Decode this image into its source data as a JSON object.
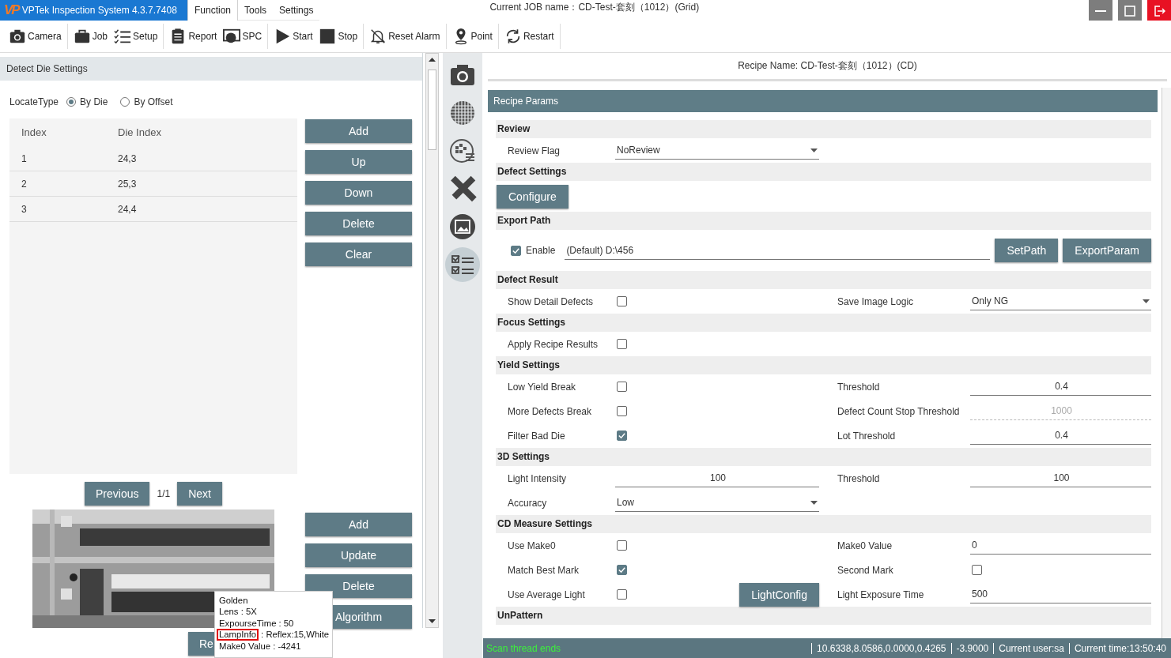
{
  "app": {
    "logo": "VP",
    "title": "VPTek Inspection System 4.3.7.7408"
  },
  "menu": [
    {
      "label": "Function",
      "selected": true
    },
    {
      "label": "Tools",
      "selected": false
    },
    {
      "label": "Settings",
      "selected": false
    }
  ],
  "job_name": "Current JOB name：CD-Test-套刻（1012）(Grid)",
  "toolbar": [
    {
      "items": [
        {
          "label": "Camera"
        }
      ]
    },
    {
      "items": [
        {
          "label": "Job"
        },
        {
          "label": "Setup"
        }
      ]
    },
    {
      "items": [
        {
          "label": "Report"
        },
        {
          "label": "SPC"
        }
      ]
    },
    {
      "items": [
        {
          "label": "Start"
        },
        {
          "label": "Stop"
        }
      ]
    },
    {
      "items": [
        {
          "label": "Reset Alarm"
        }
      ]
    },
    {
      "items": [
        {
          "label": "Point"
        }
      ]
    },
    {
      "items": [
        {
          "label": "Restart"
        }
      ]
    }
  ],
  "detect_die": {
    "title": "Detect Die Settings",
    "locate_type": {
      "label": "LocateType",
      "options": [
        {
          "label": "By Die",
          "selected": true
        },
        {
          "label": "By Offset",
          "selected": false
        }
      ]
    },
    "table": {
      "columns": [
        "Index",
        "Die Index"
      ],
      "rows": [
        [
          "1",
          "24,3"
        ],
        [
          "2",
          "25,3"
        ],
        [
          "3",
          "24,4"
        ]
      ]
    },
    "buttons": [
      "Add",
      "Up",
      "Down",
      "Delete",
      "Clear"
    ],
    "pager": {
      "previous": "Previous",
      "page": "1/1",
      "next": "Next"
    },
    "image": {
      "kind": "picture"
    },
    "image_buttons": [
      "Add",
      "Update",
      "Delete",
      "Algorithm"
    ],
    "bottom_button": "Re",
    "tooltip": [
      {
        "text": "Golden"
      },
      {
        "text": "Lens : 5X"
      },
      {
        "text": "ExpourseTime : 50"
      },
      {
        "highlight": "LampInfo",
        "text": ": Reflex:15,White"
      },
      {
        "text": "Make0 Value : -4241"
      }
    ]
  },
  "sidebar": [
    {
      "selected": false
    },
    {
      "selected": false
    },
    {
      "selected": false
    },
    {
      "selected": false
    },
    {
      "selected": false
    },
    {
      "selected": true
    }
  ],
  "recipe": {
    "name": "Recipe Name: CD-Test-套刻（1012）(CD)",
    "title": "Recipe Params",
    "sections": [
      {
        "title": "Review",
        "rows": [
          {
            "kind": "pair",
            "label": "Review Flag",
            "control": {
              "kind": "dropdown",
              "value": "NoReview"
            }
          }
        ]
      },
      {
        "title": "Defect Settings",
        "rows": [
          {
            "kind": "button",
            "label": "Configure"
          }
        ]
      },
      {
        "title": "Export Path",
        "rows": [
          {
            "kind": "path",
            "checkbox": {
              "label": "Enable",
              "checked": true
            },
            "value": "(Default) D:\\456",
            "buttons": [
              "SetPath",
              "ExportParam"
            ]
          }
        ]
      },
      {
        "title": "Defect Result",
        "rows": [
          {
            "kind": "pair",
            "label": "Show Detail Defects",
            "control": {
              "kind": "checkbox",
              "checked": false
            },
            "right_label": "Save Image Logic",
            "right_control": {
              "kind": "dropdown",
              "value": "Only NG"
            }
          }
        ]
      },
      {
        "title": "Focus Settings",
        "rows": [
          {
            "kind": "pair",
            "label": "Apply Recipe Results",
            "control": {
              "kind": "checkbox",
              "checked": false
            }
          }
        ]
      },
      {
        "title": "Yield Settings",
        "rows": [
          {
            "kind": "pair",
            "label": "Low Yield Break",
            "control": {
              "kind": "checkbox",
              "checked": false
            },
            "right_label": "Threshold",
            "right_control": {
              "kind": "number",
              "value": "0.4",
              "disabled": false
            }
          },
          {
            "kind": "pair",
            "label": "More Defects Break",
            "control": {
              "kind": "checkbox",
              "checked": false
            },
            "right_label": "Defect Count Stop Threshold",
            "right_control": {
              "kind": "number",
              "value": "1000",
              "disabled": true
            }
          },
          {
            "kind": "pair",
            "label": "Filter Bad Die",
            "control": {
              "kind": "checkbox",
              "checked": true
            },
            "right_label": "Lot Threshold",
            "right_control": {
              "kind": "number",
              "value": "0.4",
              "disabled": false
            }
          }
        ]
      },
      {
        "title": "3D Settings",
        "rows": [
          {
            "kind": "pair",
            "label": "Light Intensity",
            "control": {
              "kind": "number",
              "value": "100",
              "disabled": false
            },
            "right_label": "Threshold",
            "right_control": {
              "kind": "number",
              "value": "100",
              "disabled": false
            }
          },
          {
            "kind": "pair",
            "label": "Accuracy",
            "control": {
              "kind": "dropdown",
              "value": "Low"
            }
          }
        ]
      },
      {
        "title": "CD Measure Settings",
        "rows": [
          {
            "kind": "pair",
            "label": "Use Make0",
            "control": {
              "kind": "checkbox",
              "checked": false
            },
            "right_label": "Make0 Value",
            "right_control": {
              "kind": "field",
              "value": "0",
              "disabled": false
            }
          },
          {
            "kind": "pair",
            "label": "Match Best Mark",
            "control": {
              "kind": "checkbox",
              "checked": true
            },
            "right_label": "Second Mark",
            "right_control": {
              "kind": "checkbox",
              "checked": false
            }
          },
          {
            "kind": "pair",
            "label": "Use Average Light",
            "control": {
              "kind": "checkbox",
              "checked": false
            },
            "button": "LightConfig",
            "right_label": "Light Exposure Time",
            "right_control": {
              "kind": "field",
              "value": "500",
              "disabled": false
            }
          }
        ]
      },
      {
        "title": "UnPattern"
      }
    ]
  },
  "status": {
    "message": "Scan thread ends",
    "fields": [
      "10.6338,8.0586,0.0000,0.4265",
      "-3.9000",
      "Current user:sa",
      "Current time:13:50:40"
    ]
  }
}
